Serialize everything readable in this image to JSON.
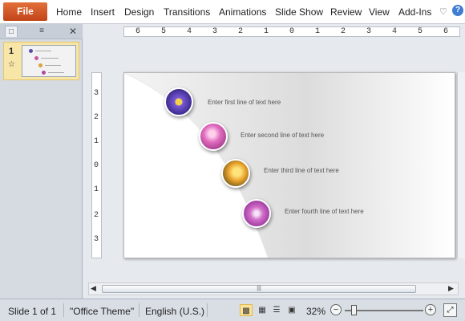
{
  "ribbon": {
    "file_label": "File",
    "tabs": [
      "Home",
      "Insert",
      "Design",
      "Transitions",
      "Animations",
      "Slide Show",
      "Review",
      "View",
      "Add-Ins"
    ]
  },
  "slides_panel": {
    "slide_number": "1"
  },
  "ruler": {
    "horizontal_marks": [
      "6",
      "5",
      "4",
      "3",
      "2",
      "1",
      "0",
      "1",
      "2",
      "3",
      "4",
      "5",
      "6"
    ],
    "vertical_marks": [
      "3",
      "2",
      "1",
      "0",
      "1",
      "2",
      "3"
    ]
  },
  "slide": {
    "lines": [
      {
        "text": "Enter  first line of text here",
        "icon": "purple-flower"
      },
      {
        "text": "Enter  second line of text here",
        "icon": "pink-flower"
      },
      {
        "text": "Enter  third line of text here",
        "icon": "yellow-flower"
      },
      {
        "text": "Enter  fourth line of text here",
        "icon": "magenta-flower"
      }
    ]
  },
  "status_bar": {
    "slide_info": "Slide 1 of 1",
    "theme": "\"Office Theme\"",
    "language": "English (U.S.)",
    "zoom": "32%"
  },
  "colors": {
    "file_tab": "#d2542a",
    "selected_thumb": "#f7e6a8",
    "active_view": "#fbe39a"
  }
}
